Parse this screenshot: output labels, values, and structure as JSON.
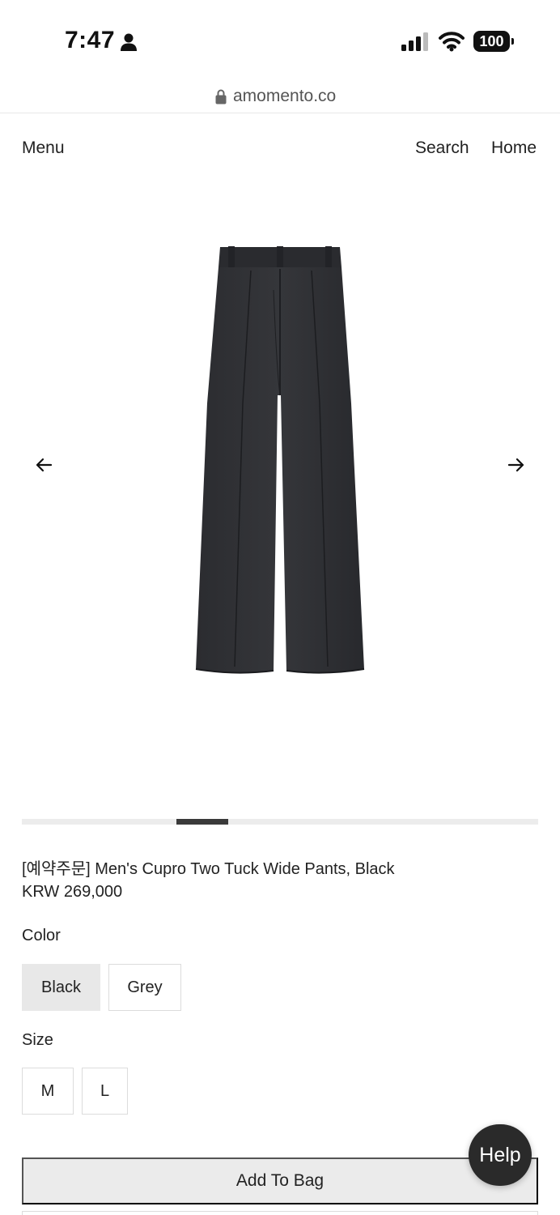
{
  "status_bar": {
    "time": "7:47",
    "battery": "100",
    "icons": [
      "person-icon",
      "signal-icon",
      "wifi-icon",
      "battery-icon"
    ]
  },
  "browser": {
    "url": "amomento.co",
    "icons": [
      "lock-icon"
    ]
  },
  "nav": {
    "menu": "Menu",
    "search": "Search",
    "home": "Home"
  },
  "gallery": {
    "prev_icon": "arrow-left-icon",
    "next_icon": "arrow-right-icon",
    "progress": {
      "start": 0.3,
      "end": 0.4
    },
    "colors": {
      "thumb": "#3a3a3a",
      "track": "#ececec"
    }
  },
  "product": {
    "title": "[예약주문] Men's Cupro Two Tuck Wide Pants, Black",
    "price": "KRW 269,000"
  },
  "options": {
    "color_label": "Color",
    "colors": [
      {
        "label": "Black",
        "selected": true
      },
      {
        "label": "Grey",
        "selected": false
      }
    ],
    "size_label": "Size",
    "sizes": [
      {
        "label": "M",
        "selected": false
      },
      {
        "label": "L",
        "selected": false
      }
    ]
  },
  "actions": {
    "add_to_bag": "Add To Bag",
    "help": "Help"
  }
}
